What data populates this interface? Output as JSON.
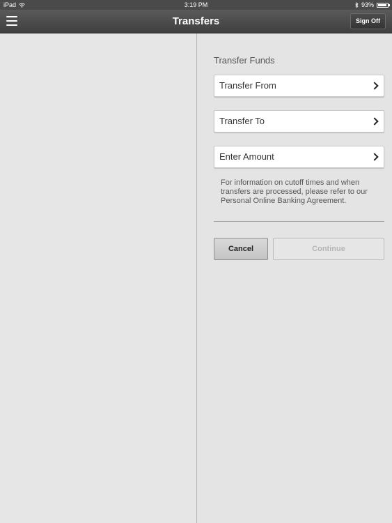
{
  "status_bar": {
    "device": "iPad",
    "time": "3:19 PM",
    "battery_percent": "93%",
    "battery_level": 0.93
  },
  "nav": {
    "title": "Transfers",
    "sign_off_label": "Sign Off"
  },
  "form": {
    "section_title": "Transfer Funds",
    "fields": [
      {
        "label": "Transfer From"
      },
      {
        "label": "Transfer To"
      },
      {
        "label": "Enter Amount"
      }
    ],
    "info_text": "For information on cutoff times and when transfers are processed, please refer to our Personal Online Banking Agreement.",
    "cancel_label": "Cancel",
    "continue_label": "Continue"
  },
  "colors": {
    "nav_bar": "#4a4a4a",
    "background": "#e4e4e4",
    "disabled_text": "#b5b5b5"
  }
}
